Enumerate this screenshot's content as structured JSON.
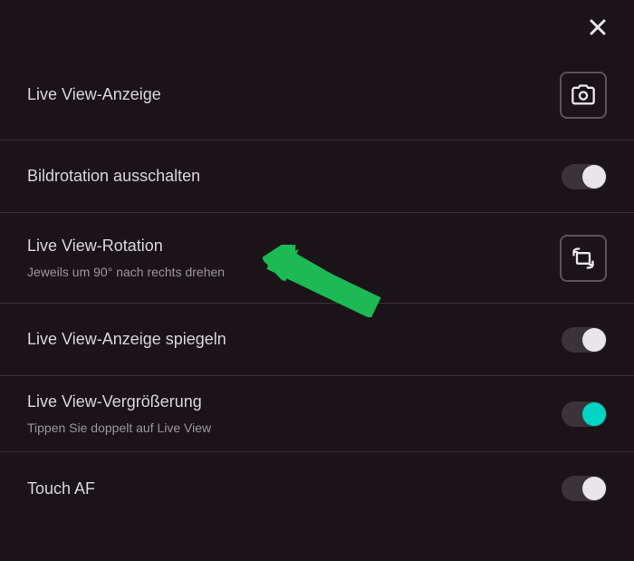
{
  "settings": {
    "items": [
      {
        "title": "Live View-Anzeige",
        "subtitle": "",
        "type": "action",
        "icon": "camera"
      },
      {
        "title": "Bildrotation ausschalten",
        "subtitle": "",
        "type": "toggle",
        "enabled": false
      },
      {
        "title": "Live View-Rotation",
        "subtitle": "Jeweils um 90° nach rechts drehen",
        "type": "action",
        "icon": "rotate"
      },
      {
        "title": "Live View-Anzeige spiegeln",
        "subtitle": "",
        "type": "toggle",
        "enabled": false
      },
      {
        "title": "Live View-Vergrößerung",
        "subtitle": "Tippen Sie doppelt auf Live View",
        "type": "toggle",
        "enabled": true
      },
      {
        "title": "Touch AF",
        "subtitle": "",
        "type": "toggle",
        "enabled": false
      }
    ]
  }
}
